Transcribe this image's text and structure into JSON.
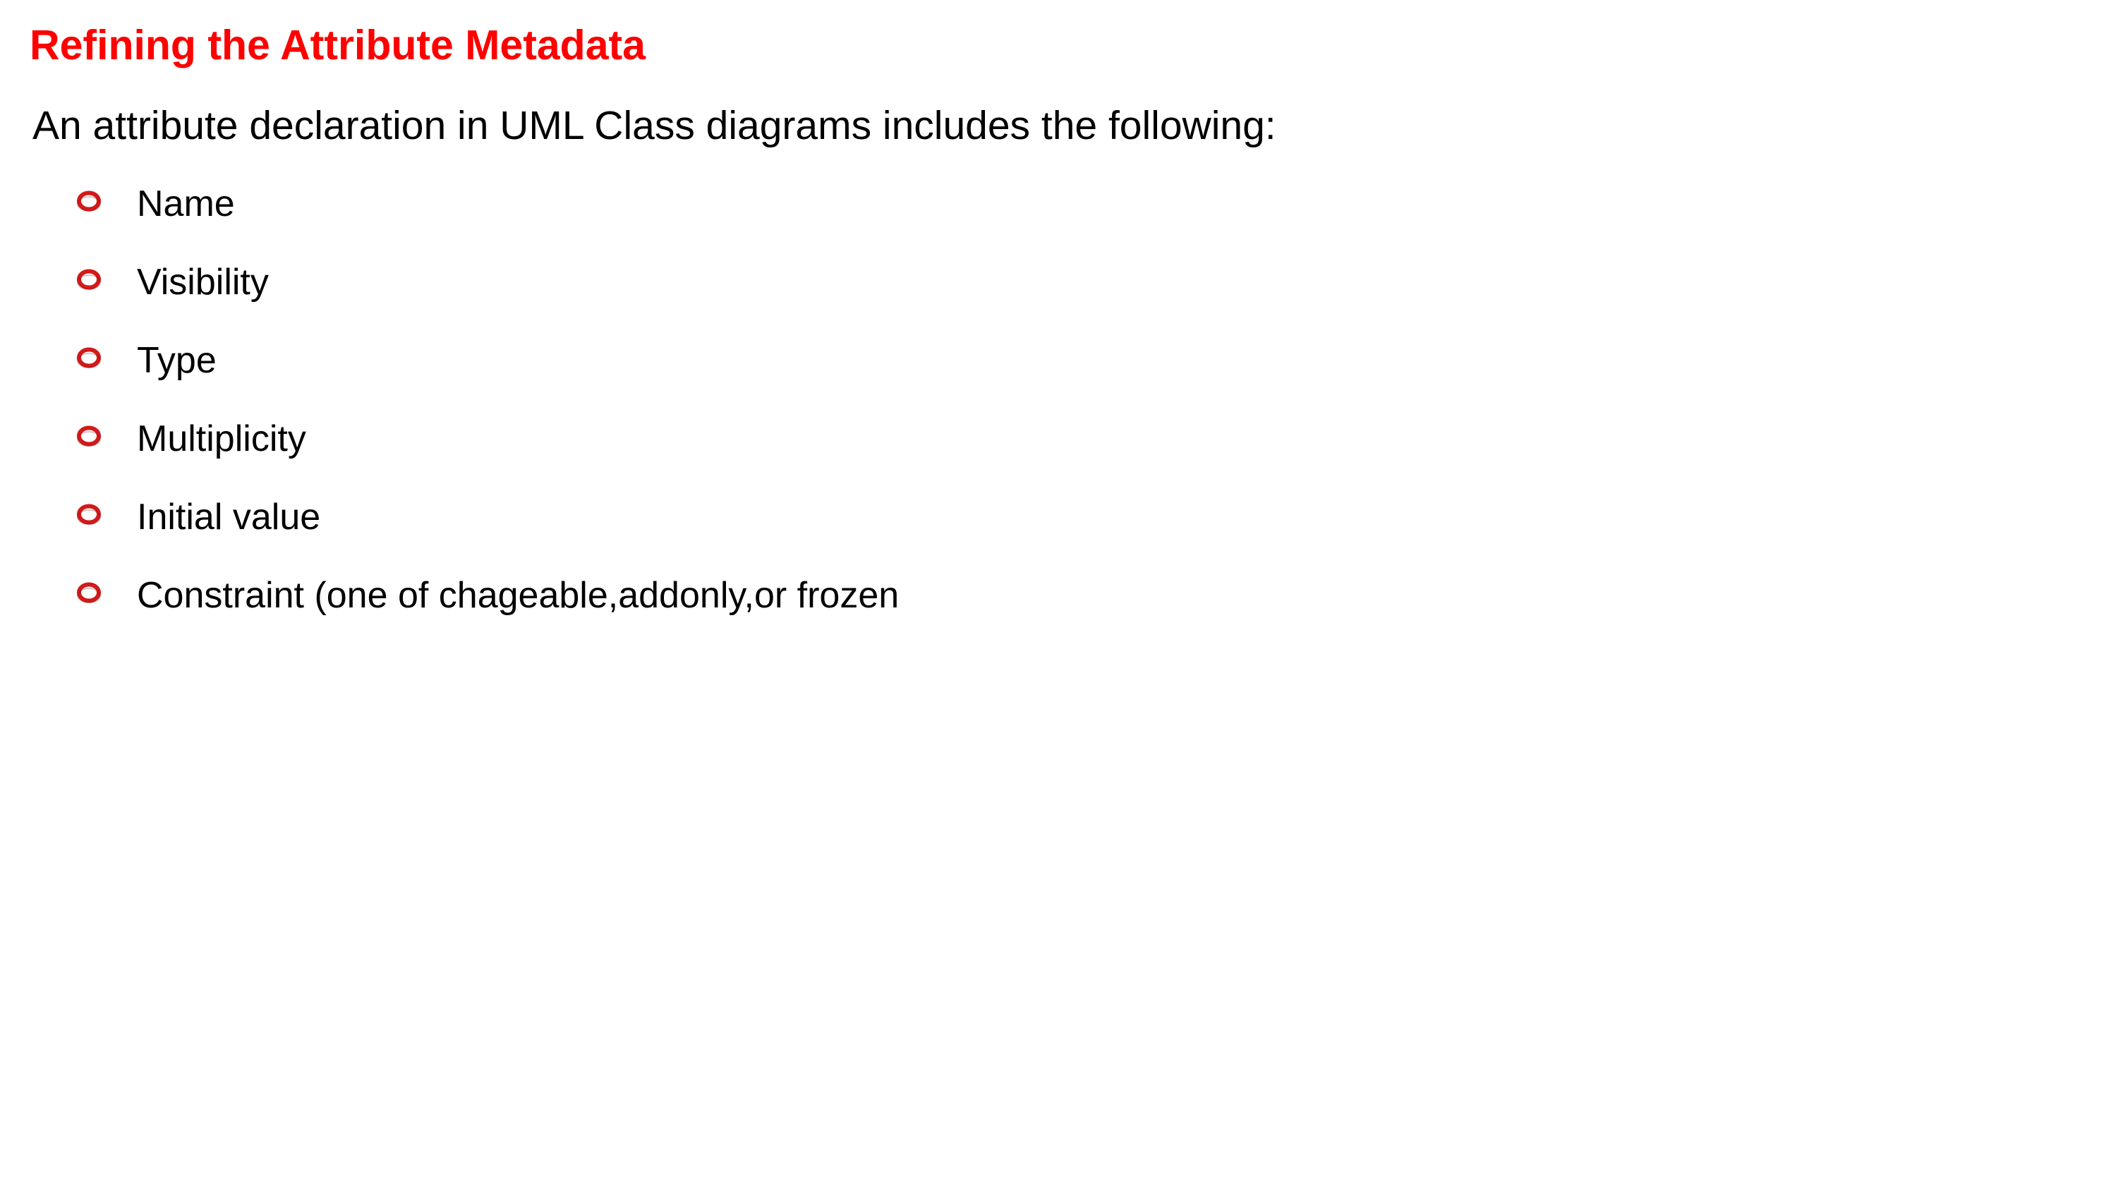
{
  "slide": {
    "title": "Refining the Attribute Metadata",
    "intro": "An attribute declaration in UML Class diagrams includes the following:",
    "bullet_icon": "hollow-red-ring-icon",
    "colors": {
      "title": "#ff0000",
      "text": "#000000",
      "bullet": "#d11a1a",
      "background": "#ffffff"
    },
    "items": [
      {
        "label": "Name"
      },
      {
        "label": "Visibility"
      },
      {
        "label": "Type"
      },
      {
        "label": "Multiplicity"
      },
      {
        "label": "Initial value"
      },
      {
        "label": "Constraint (one of chageable,addonly,or frozen"
      }
    ]
  }
}
